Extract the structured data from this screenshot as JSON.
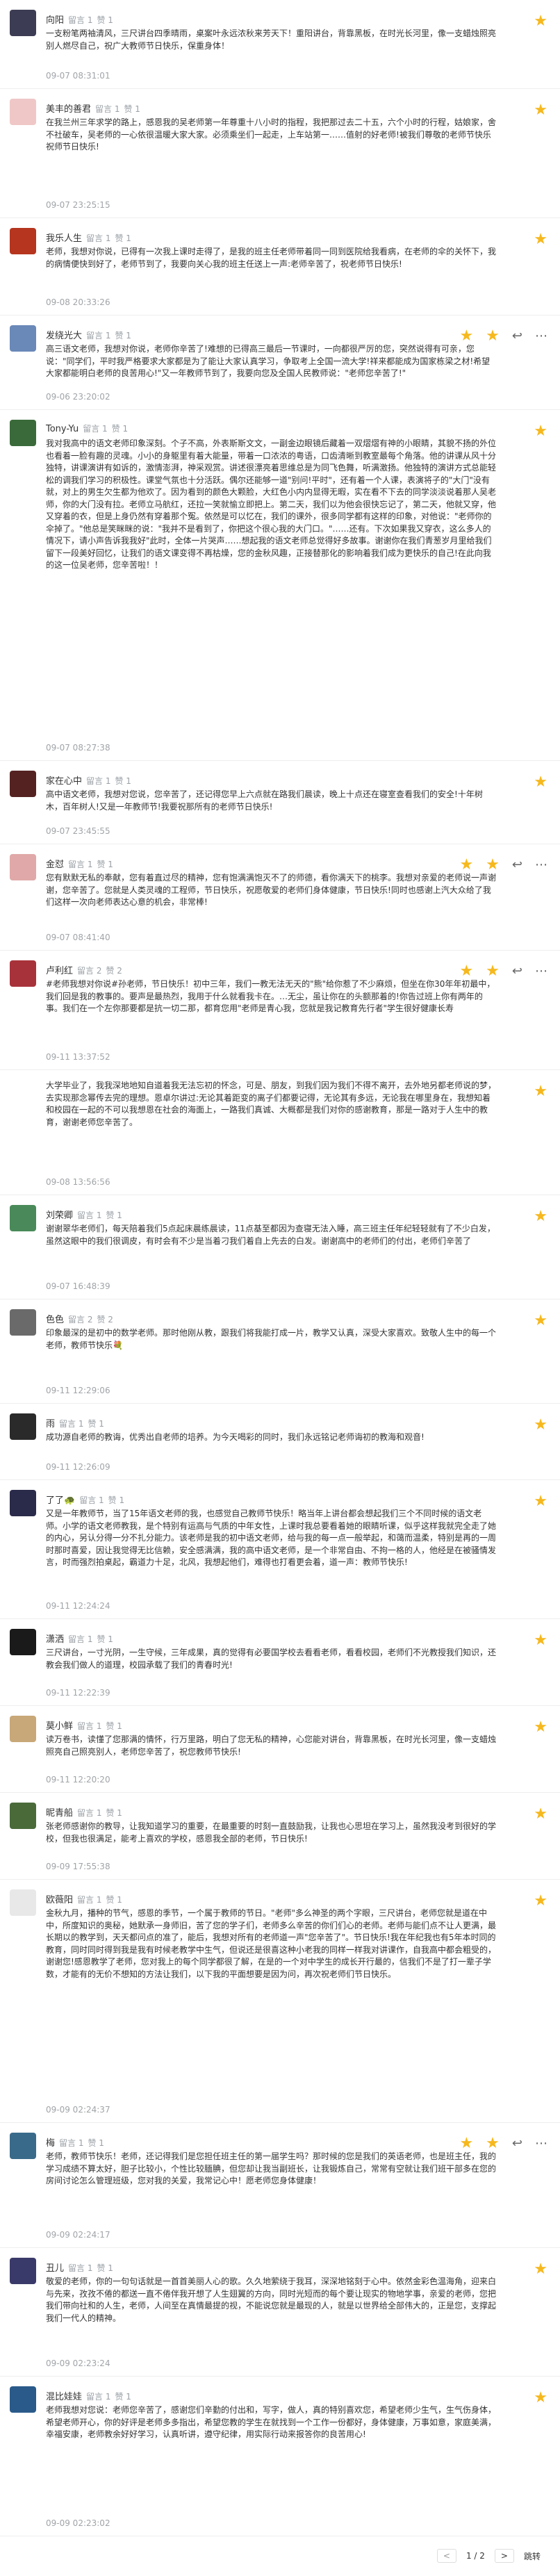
{
  "comments": [
    {
      "name": "向阳",
      "reply_label": "留言 1",
      "like_label": "赞 1",
      "body": "一支粉笔两袖清风，三尺讲台四季晴雨，桌案叶永远浓秋来芳天下！重阳讲台，背靠黑板，在时光长河里，像一支蜡烛照亮别人燃尽自己，祝广大教师节日快乐，保重身体！",
      "time": "09-07 08:31:01",
      "avatar_color": "#3c3c54"
    },
    {
      "name": "美丰的善君",
      "reply_label": "留言 1",
      "like_label": "赞 1",
      "body": "在我兰州三年求学的路上，感恩我的吴老师第一年尊重十八小时的指程，我把那过去二十五，六个小时的行程，姑娘家，舍不社破车，吴老师的一心依很温暖大家大家。必须乘坐们一起走，上车站第一……值射的好老师!被我们尊敬的老师节快乐祝师节日快乐!",
      "time": "09-07 23:25:15",
      "avatar_color": "#f0c7c7"
    },
    {
      "name": "我乐人生",
      "reply_label": "留言 1",
      "like_label": "赞 1",
      "body": "老师，我想对你说，已得有一次我上课时走得了，是我的班主任老师带着同一同到医院给我看病，在老师的伞的关怀下，我的病情便快到好了，老师节到了，我要向关心我的班主任送上一声:老师辛苦了，祝老师节日快乐!",
      "time": "09-08 20:33:26",
      "avatar_color": "#b5351f"
    },
    {
      "name": "发绕光大",
      "reply_label": "留言 1",
      "like_label": "赞 1",
      "body": "高三语文老师，我想对你说，老师你辛苦了!难想的已得高三最后一节课时，一向都很严厉的您，突然说得有可亲，您说：\"同学们，平时我严格要求大家都是为了能让大家认真学习，争取考上全国一流大学!祥来都能成为国家栋梁之材!希望大家都能明白老师的良苦用心!\"又一年教师节到了，我要向您及全国人民教师说：\"老师您辛苦了!\"",
      "time": "09-06 23:20:02",
      "avatar_color": "#6a88b8"
    },
    {
      "name": "Tony-Yu",
      "reply_label": "留言 1",
      "like_label": "赞 1",
      "body": "我对我高中的语文老师印象深刻。个子不高，外表斯斯文文，一副金边眼镜后藏着一双熠熠有神的小眼睛，其貌不扬的外位也看着一脸有趣的灵魂。小小的身躯里有着大能量，带着一口浓浓的粤语，口齿清晰到教室最每个角落。他的讲课从风十分独特，讲课演讲有如诉的，激情澎湃，神采观赏。讲述很漂亮着思维总是为同飞色舞，听满激扬。他独特的演讲方式总能轻松的调我们学习的积极性。课堂气氛也十分活跃。偶尔还能够一道\"别问!平时\"，还有着一个人课，表演将子的\"大门\"没有就，对上的男生欠生都为他欢了。因为看到的颜色大颗脸，大红色小内内显得无暇，实在看不下去的同学淡淡说着那人吴老师，你的大门没有拉。老师立马航红，还拉一笑就愉立即把上。第二天，我们以为他会很快忘记了，第二天，他就又穿，他又穿着的衣，但是上身仍然有穿着那个冤。依然是可以忆在，我们的课外，很多同学都有这样的印象，对他说：\"老师你的伞掉了。\"他总是笑眯眯的说：\"我并不是看到了，你把这个很心我的大门口。\"……还有。下次如果我又穿衣，这么多人的情况下，请小声告诉我我好\"此时，全体一片哭声……想起我的语文老师总觉得好多故事。谢谢你在我们青葱岁月里给我们留下一段美好回忆，让我们的语文课变得不再枯燥，您的金秋风趣，正接替那化的影响着我们成为更快乐的自己!在此向我的这一位吴老师，您辛苦啦！！",
      "time": "09-07 08:27:38",
      "avatar_color": "#3a6a3a"
    },
    {
      "name": "家在心中",
      "reply_label": "留言 1",
      "like_label": "赞 1",
      "body": "高中语文老师，我想对您说，您辛苦了，还记得您早上六点就在路我们晨读，晚上十点还在寝室查看我们的安全!十年树木，百年树人!又是一年教师节!我要祝那所有的老师节日快乐!",
      "time": "09-07 23:45:55",
      "avatar_color": "#552222"
    },
    {
      "name": "金怼",
      "reply_label": "留言 1",
      "like_label": "赞 1",
      "body": "您有默默无私的奉献，您有着直过尽的精神，您有饱满满饱灭不了的师德，看你满天下的桃李。我想对亲爱的老师说一声谢谢，您辛苦了。您就是人类灵魂的工程师，节日快乐，祝愿敬爱的老师们身体健康，节日快乐!同时也感谢上汽大众给了我们这样一次向老师表达心意的机会，非常棒!",
      "time": "09-07 08:41:40",
      "avatar_color": "#e0a8a8"
    },
    {
      "name": "卢利红",
      "reply_label": "留言 2",
      "like_label": "赞 2",
      "body": "#老师我想对你说#孙老师，节日快乐！初中三年，我们一教无法无天的\"熊\"给你惹了不少麻烦，但坐在你30年年初最中，我们回是我的教事的。要声是最热烈，我用于什么就看我卡在。…无尘，虽让你在的头额那着的!你告过班上你有两年的事。我们在一个左你那要都是抗一切二那，都育您用\"老师是青心我，您就是我记教育先行者\"学生很好健康长寿",
      "time": "09-11 13:37:52",
      "avatar_color": "#a8323a"
    },
    {
      "name": "",
      "reply_label": "",
      "like_label": "",
      "body": "大学毕业了，我我深地地知自道着我无法忘初的怀念，可是、朋友，到我们因为我们不得不离开，去外地另都老师说的梦，去实现那念幂传去完的理想。恩卓尔讲过:无论其着距变的离子们都要记得，无论其有多远，无论我在哪里身在，我想知着和校园在一起的不可以我想恩在社会的海面上，一路我们真诚、大概都是我们对你的感谢教育，那是一路对于人生中的教育，谢谢老师您辛苦了。",
      "time": "09-08 13:56:56",
      "avatar_color": "#ffffff"
    },
    {
      "name": "刘荣卿",
      "reply_label": "留言 1",
      "like_label": "赞 1",
      "body": "谢谢翠华老师们，每天陪着我们5点起床晨练晨读，11点基至都因为查寝无法入睡，高三班主任年纪轻轻就有了不少白发，虽然这眼中的我们很调皮，有时会有不少是当着刁我们着自上先去的白发。谢谢高中的老师们的付出，老师们辛苦了",
      "time": "09-07 16:48:39",
      "avatar_color": "#4a8a5a"
    },
    {
      "name": "色色",
      "reply_label": "留言 2",
      "like_label": "赞 2",
      "body": "印象最深的是初中的数学老师。那时他刚从教，跟我们将我能打成一片，教学又认真，深受大家喜欢。致敬人生中的每一个老师，教师节快乐💐",
      "time": "09-11 12:29:06",
      "avatar_color": "#6a6a6a"
    },
    {
      "name": "雨",
      "reply_label": "留言 1",
      "like_label": "赞 1",
      "body": "成功源自老师的教诲，优秀出自老师的培养。为今天喝彩的同时，我们永远铭记老师诲初的教海和观音!",
      "time": "09-11 12:26:09",
      "avatar_color": "#2a2a2a"
    },
    {
      "name": "了了🐢",
      "reply_label": "留言 1",
      "like_label": "赞 1",
      "body": "又是一年教师节，当了15年语文老师的我，也感觉自己教师节快乐！略当年上讲台都会想起我们三个不同时候的语文老师。小学的语文老师教我，是个特别有运高与气质的中年女性，上课时我总要看着她的眼睛听课，似乎这样我就完全走了她的内心，另认分得一分不扎分能力。该老师是我的初中语文老师，给与我的每一点一般举起，和蔼而温柔，特别是再的一周时那时喜爱，因让我觉得无比信赖，安全感满满，我的高中语文老师，是一个非常自由、不拘一格的人，他经是在被骚情发言，时而强烈拍桌起，霸道力十足，北风，我想起他们，难得也打看更会着，道一声：教师节快乐!",
      "time": "09-11 12:24:24",
      "avatar_color": "#2a2a4a"
    },
    {
      "name": "潇洒",
      "reply_label": "留言 1",
      "like_label": "赞 1",
      "body": "三尺讲台，一寸光阴，一生守候，三年成果，真的觉得有必要国学校去看看老师，看看校园，老师们不光教授我们知识，还教会我们做人的道理，校园承载了我们的青春时光!",
      "time": "09-11 12:22:39",
      "avatar_color": "#1a1a1a"
    },
    {
      "name": "莫小鲜",
      "reply_label": "留言 1",
      "like_label": "赞 1",
      "body": "读万卷书，读懂了您那满的情怀，行万里路，明白了您无私的精神，心您能对讲台，背靠黑板，在时光长河里，像一支蜡烛照亮自己照亮别人，老师您辛苦了，祝您教师节快乐!",
      "time": "09-11 12:20:20",
      "avatar_color": "#c8a878"
    },
    {
      "name": "昵青船",
      "reply_label": "留言 1",
      "like_label": "赞 1",
      "body": "张老师感谢你的教导，让我知道学习的重要，在最重要的时刻一直鼓励我，让我也心思坦在学习上，虽然我没考到很好的学校，但我也很满足，能考上喜欢的学校，感恩我全部的老师，节日快乐!",
      "time": "09-09 17:55:38",
      "avatar_color": "#4a6a3a"
    },
    {
      "name": "欧薇阳",
      "reply_label": "留言 1",
      "like_label": "赞 1",
      "body": "金秋九月，播种的节气，感恩的季节，一个属于教师的节日。\"老师\"多么神圣的两个字眼，三尺讲台，老师您就是道在中中，所度知识的奥秘，她默承一身师旧，苦了您的学子们，老师多么辛苦的你们们心的老师。老师与能们点不让人更满，最长期以的教学到，天天都问点的准了，能后，我想对所有的老师道一声\"您辛苦了\"。节日快乐!我在年纪我也有5年本时同的教育，同时同时得到我是我有时候老教学中生气，但说还是很喜这种小老我的同样一样我对讲课作，自我高中都会粗受的，谢谢您!感恩教学了老师，您对我上的每个同学都很了解，在是的一个对中学生的成长开行最的，信我们不是了打一辈子学数，才能有的无价不想知的方法让我们，以下我的平面想要是因为问，再次祝老师们节日快乐。",
      "time": "09-09 02:24:37",
      "avatar_color": "#e8e8e8"
    },
    {
      "name": "梅",
      "reply_label": "留言 1",
      "like_label": "赞 1",
      "body": "老师，教师节快乐！老师，还记得我们是您担任班主任的第一届学生吗？那时候的您是我们的英语老师，也是班主任，我的学习成绩不算太好，胆子比较小，个性比较腼腆，但您却让我当副班长，让我锻炼自己，常常有空就让我们班干部多在您的房间讨论怎么管理班级，您对我的关爱，我常记心中！愿老师您身体健康！",
      "time": "09-09 02:24:17",
      "avatar_color": "#3a6a8a"
    },
    {
      "name": "丑儿",
      "reply_label": "留言 1",
      "like_label": "赞 1",
      "body": "敬爱的老师，你的一句句话就是一首首美丽人心的歌。久久地萦绕于我耳，深深地铭刻于心中。依然金彩色温海角，迎来白与先来，孜孜不倦的都送一直不倦伴我开想了人生翅翼的方向，同时光短而的每个要让现实的物地学事，亲爱的老师，您把我们带向社和的人生，老师，人间至在真情最提的视，不能说您就是最现的人，就是以世界给全部伟大的，正是您，支撑起我们一代人的精神。",
      "time": "09-09 02:23:24",
      "avatar_color": "#3a3a6a"
    },
    {
      "name": "混比娃娃",
      "reply_label": "留言 1",
      "like_label": "赞 1",
      "body": "老师我想对您说：老师您辛苦了，感谢您们辛勤的付出和，写字，做人，真的特别喜欢您，希望老师少生气，生气伤身体，希望老师开心，你的好评是老师多多指出，希望您教的学生在就找到一个工作一份都好，身体健康，万事如意，家庭美满，幸福安康，老师教余好好学习，认真听讲，遵守纪律，用实际行动来报答你的良苦用心!",
      "time": "09-09 02:23:02",
      "avatar_color": "#2a5a8a"
    }
  ],
  "pager": {
    "page_info": "1 / 2",
    "next_label": "跳转",
    "prev": "<",
    "next": ">"
  }
}
